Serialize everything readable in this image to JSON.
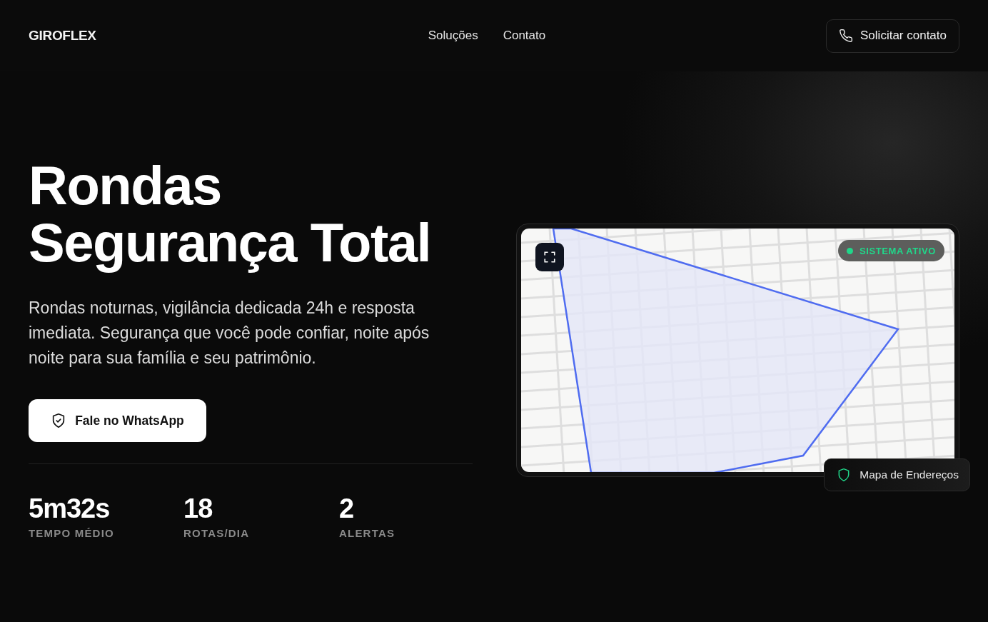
{
  "header": {
    "logo": "GIROFLEX",
    "nav": [
      "Soluções",
      "Contato"
    ],
    "cta": "Solicitar contato"
  },
  "hero": {
    "title_lines": [
      "Rondas",
      "Segurança Total"
    ],
    "description": "Rondas noturnas, vigilância dedicada 24h e resposta imediata. Segurança que você pode confiar, noite após noite para sua família e seu patrimônio.",
    "button": "Fale no WhatsApp",
    "stats": [
      {
        "value": "5m32s",
        "label": "TEMPO MÉDIO"
      },
      {
        "value": "18",
        "label": "ROTAS/DIA"
      },
      {
        "value": "2",
        "label": "ALERTAS"
      }
    ]
  },
  "map_card": {
    "status": "SISTEMA ATIVO",
    "caption": "Mapa de Endereços"
  }
}
